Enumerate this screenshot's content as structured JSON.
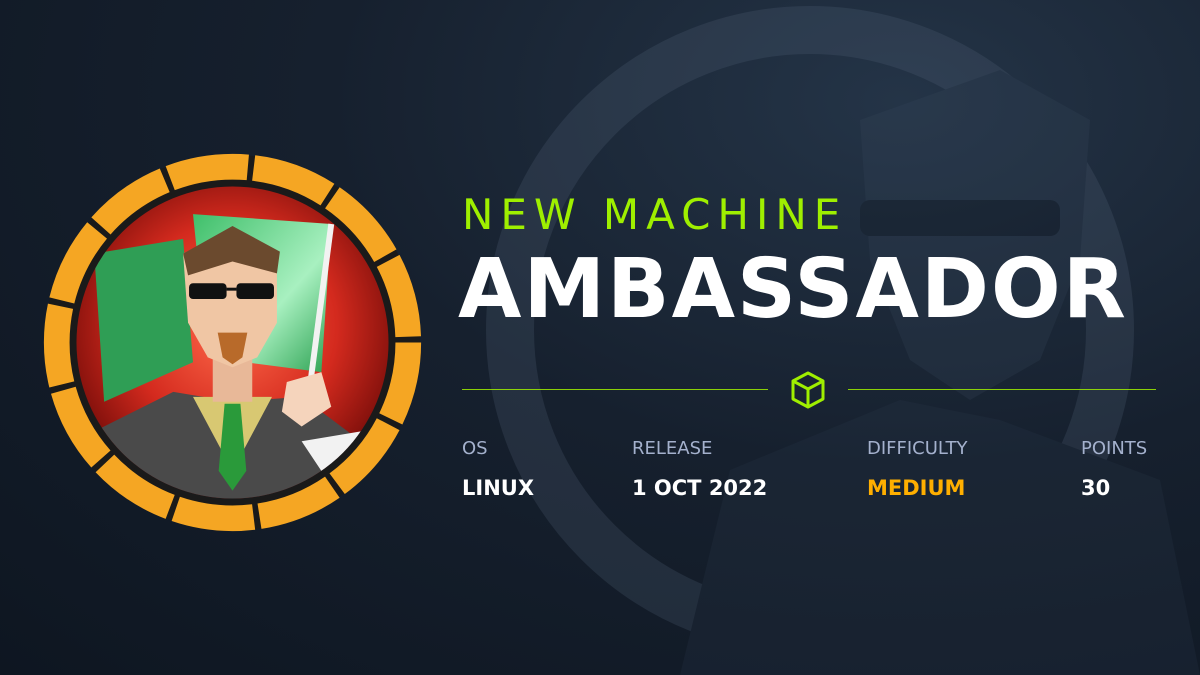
{
  "header": {
    "headline": "NEW MACHINE",
    "machine_name": "AMBASSADOR"
  },
  "stats": {
    "os": {
      "label": "OS",
      "value": "LINUX"
    },
    "release": {
      "label": "RELEASE",
      "value": "1 OCT 2022"
    },
    "difficulty": {
      "label": "DIFFICULTY",
      "value": "MEDIUM"
    },
    "points": {
      "label": "POINTS",
      "value": "30"
    }
  },
  "icons": {
    "divider": "cube-icon",
    "avatar": "ambassador-avatar-badge"
  },
  "colors": {
    "accent_green": "#9fef00",
    "difficulty_medium": "#ffaf00",
    "badge_ring": "#f5a623",
    "label_gray": "#a4b1cd",
    "background": "#16202e"
  }
}
